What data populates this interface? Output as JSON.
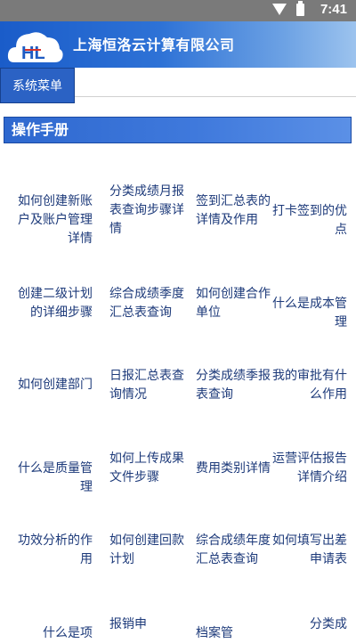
{
  "status_bar": {
    "time": "7:41",
    "icons": [
      "wifi-icon",
      "battery-icon"
    ]
  },
  "header": {
    "company_name": "上海恒洛云计算有限公司",
    "logo_text": "HL"
  },
  "menu": {
    "button_label": "系统菜单"
  },
  "section": {
    "title": "操作手册"
  },
  "manual_items": [
    [
      "如何创建新账户及账户管理详情",
      "分类成绩月报表查询步骤详情",
      "签到汇总表的详情及作用",
      "打卡签到的优点"
    ],
    [
      "创建二级计划的详细步骤",
      "综合成绩季度汇总表查询",
      "如何创建合作单位",
      "什么是成本管理"
    ],
    [
      "如何创建部门",
      "日报汇总表查询情况",
      "分类成绩季报表查询",
      "我的审批有什么作用"
    ],
    [
      "什么是质量管理",
      "如何上传成果文件步骤",
      "费用类别详情",
      "运营评估报告详情介绍"
    ],
    [
      "功效分析的作用",
      "如何创建回款计划",
      "综合成绩年度汇总表查询",
      "如何填写出差申请表"
    ],
    [
      "什么是项",
      "报销申",
      "档案管",
      "分类成"
    ]
  ],
  "colors": {
    "accent": "#2b62c4",
    "link_text": "#1d3a7a",
    "status_bar": "#7a7a7a"
  }
}
